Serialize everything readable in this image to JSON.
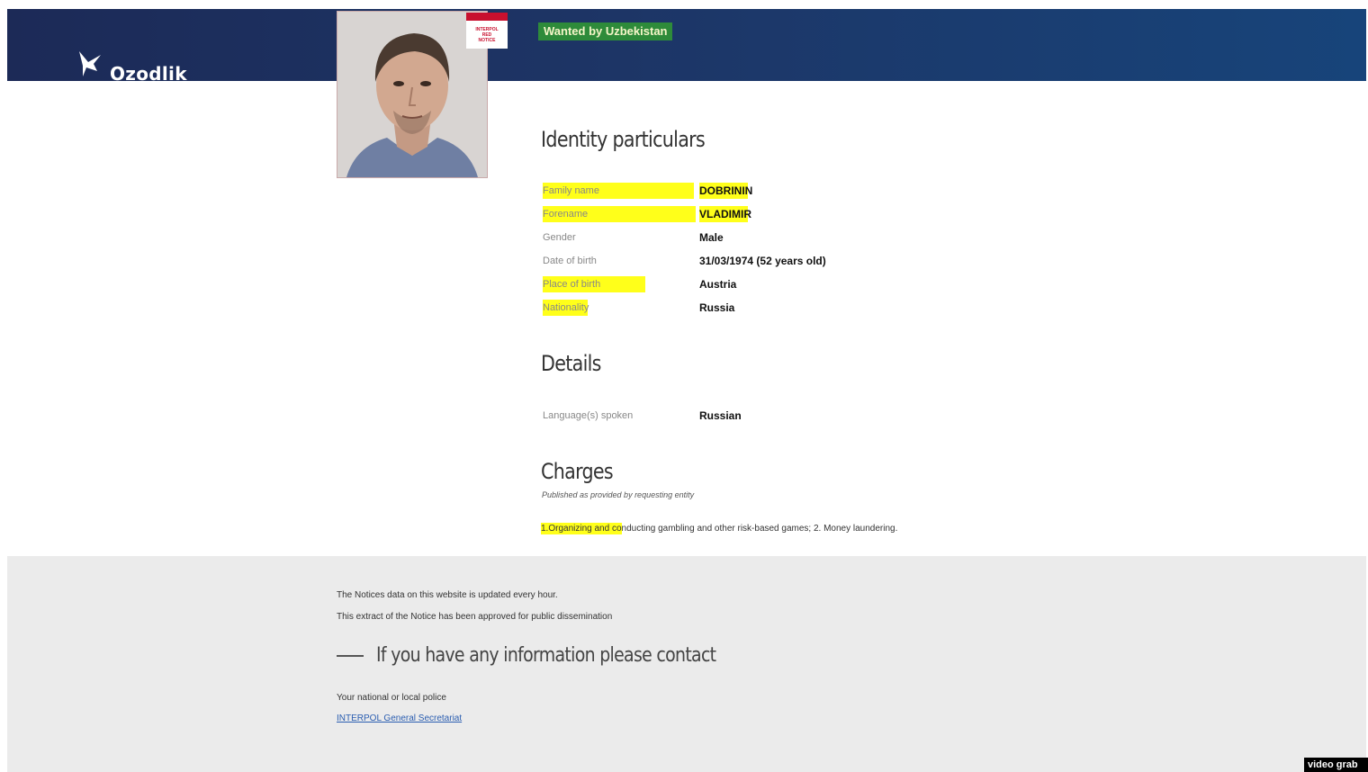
{
  "header": {
    "logo_text": "Ozodlik",
    "wanted_tag": "Wanted by Uzbekistan",
    "badge_lines": [
      "INTERPOL",
      "RED",
      "NOTICE"
    ]
  },
  "identity": {
    "title": "Identity particulars",
    "rows": [
      {
        "label": "Family name",
        "value": "DOBRININ",
        "highlighted": true
      },
      {
        "label": "Forename",
        "value": "VLADIMIR",
        "highlighted": true
      },
      {
        "label": "Gender",
        "value": "Male",
        "highlighted": false
      },
      {
        "label": "Date of birth",
        "value": "31/03/1974 (52 years old)",
        "highlighted": false
      },
      {
        "label": "Place of birth",
        "value": "Austria",
        "highlighted": true
      },
      {
        "label": "Nationality",
        "value": "Russia",
        "highlighted": true
      }
    ]
  },
  "details": {
    "title": "Details",
    "rows": [
      {
        "label": "Language(s) spoken",
        "value": "Russian"
      }
    ]
  },
  "charges": {
    "title": "Charges",
    "subtitle": "Published as provided by requesting entity",
    "text_highlighted": "1.Organizing and co",
    "text_rest": "nducting gambling and other risk-based games; 2. Money laundering."
  },
  "footer": {
    "line1": "The Notices data on this website is updated every hour.",
    "line2": "This extract of the Notice has been approved for public dissemination",
    "contact_heading": "If you have any information please contact",
    "contact_line": "Your national or local police",
    "contact_link": "INTERPOL General Secretariat"
  },
  "watermark": "video grab",
  "colors": {
    "header": "#1d3566",
    "highlight": "#ffff1a",
    "wanted_tag": "#2e8b3a",
    "badge_red": "#c8102e",
    "footer_bg": "#ebebeb"
  }
}
